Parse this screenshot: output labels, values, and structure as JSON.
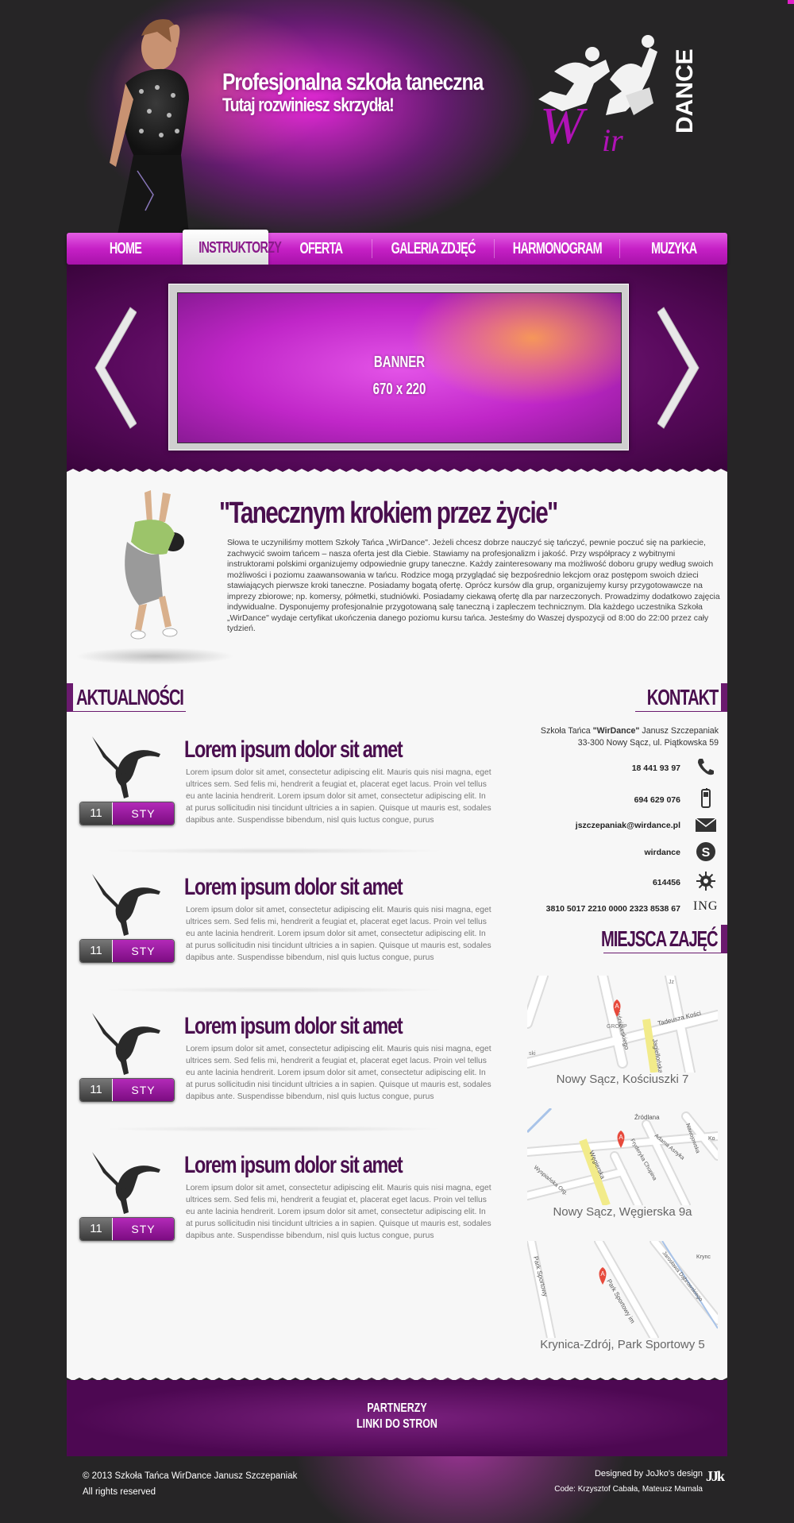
{
  "header": {
    "slogan_line1": "Profesjonalna szkoła taneczna",
    "slogan_line2": "Tutaj rozwiniesz skrzydła!",
    "logo_text_w": "W",
    "logo_text_ir": "ir",
    "logo_text_dance": "DANCE"
  },
  "nav": {
    "items": [
      {
        "label": "HOME"
      },
      {
        "label": "INSTRUKTORZY"
      },
      {
        "label": "OFERTA"
      },
      {
        "label": "GALERIA ZDJĘĆ"
      },
      {
        "label": "HARMONOGRAM"
      },
      {
        "label": "MUZYKA"
      }
    ],
    "active": "INSTRUKTORZY"
  },
  "banner": {
    "line1": "BANNER",
    "line2": "670 x 220"
  },
  "intro": {
    "title": "\"Tanecznym krokiem przez życie\"",
    "text": "Słowa te uczyniliśmy mottem Szkoły Tańca „WirDance\". Jeżeli chcesz dobrze nauczyć się tańczyć, pewnie poczuć się na parkiecie, zachwycić swoim tańcem – nasza oferta jest dla Ciebie. Stawiamy na profesjonalizm i jakość. Przy współpracy z wybitnymi instruktorami polskimi organizujemy odpowiednie grupy taneczne. Każdy zainteresowany ma możliwość doboru grupy według swoich możliwości i poziomu zaawansowania w tańcu. Rodzice mogą przyglądać się bezpośrednio lekcjom oraz postępom swoich dzieci stawiających pierwsze kroki taneczne. Posiadamy bogatą ofertę. Oprócz kursów dla grup, organizujemy kursy przygotowawcze na imprezy zbiorowe; np. komersy, półmetki, studniówki. Posiadamy ciekawą ofertę dla par narzeczonych. Prowadzimy dodatkowo zajęcia indywidualne. Dysponujemy profesjonalnie przygotowaną salę taneczną i zapleczem technicznym. Dla każdego uczestnika Szkoła „WirDance\" wydaje certyfikat ukończenia danego poziomu kursu tańca. Jesteśmy do Waszej dyspozycji od 8:00 do 22:00 przez cały tydzień."
  },
  "news": {
    "heading": "AKTUALNOŚCI",
    "items": [
      {
        "day": "11",
        "month": "STY",
        "title": "Lorem ipsum dolor sit amet",
        "text": "Lorem ipsum dolor sit amet, consectetur adipiscing elit. Mauris quis nisi magna, eget ultrices sem. Sed felis mi, hendrerit a feugiat et, placerat eget lacus. Proin vel tellus eu ante lacinia hendrerit. Lorem ipsum dolor sit amet, consectetur adipiscing elit. In at purus sollicitudin nisi tincidunt ultricies a in sapien. Quisque ut mauris est, sodales dapibus ante. Suspendisse bibendum, nisl quis luctus congue, purus"
      },
      {
        "day": "11",
        "month": "STY",
        "title": "Lorem ipsum dolor sit amet",
        "text": "Lorem ipsum dolor sit amet, consectetur adipiscing elit. Mauris quis nisi magna, eget ultrices sem. Sed felis mi, hendrerit a feugiat et, placerat eget lacus. Proin vel tellus eu ante lacinia hendrerit. Lorem ipsum dolor sit amet, consectetur adipiscing elit. In at purus sollicitudin nisi tincidunt ultricies a in sapien. Quisque ut mauris est, sodales dapibus ante. Suspendisse bibendum, nisl quis luctus congue, purus"
      },
      {
        "day": "11",
        "month": "STY",
        "title": "Lorem ipsum dolor sit amet",
        "text": "Lorem ipsum dolor sit amet, consectetur adipiscing elit. Mauris quis nisi magna, eget ultrices sem. Sed felis mi, hendrerit a feugiat et, placerat eget lacus. Proin vel tellus eu ante lacinia hendrerit. Lorem ipsum dolor sit amet, consectetur adipiscing elit. In at purus sollicitudin nisi tincidunt ultricies a in sapien. Quisque ut mauris est, sodales dapibus ante. Suspendisse bibendum, nisl quis luctus congue, purus"
      },
      {
        "day": "11",
        "month": "STY",
        "title": "Lorem ipsum dolor sit amet",
        "text": "Lorem ipsum dolor sit amet, consectetur adipiscing elit. Mauris quis nisi magna, eget ultrices sem. Sed felis mi, hendrerit a feugiat et, placerat eget lacus. Proin vel tellus eu ante lacinia hendrerit. Lorem ipsum dolor sit amet, consectetur adipiscing elit. In at purus sollicitudin nisi tincidunt ultricies a in sapien. Quisque ut mauris est, sodales dapibus ante. Suspendisse bibendum, nisl quis luctus congue, purus"
      }
    ]
  },
  "contact": {
    "heading": "KONTAKT",
    "school_prefix": "Szkoła Tańca ",
    "school_name": "\"WirDance\"",
    "school_owner": " Janusz Szczepaniak",
    "address": "33-300 Nowy Sącz, ul. Piątkowska 59",
    "phone": "18 441 93 97",
    "mobile": "694 629 076",
    "email": "jszczepaniak@wirdance.pl",
    "skype": "wirdance",
    "gg": "614456",
    "account": "3810 5017 2210 0000 2323 8538 67",
    "bank": "ING"
  },
  "places": {
    "heading": "MIEJSCA ZAJĘĆ",
    "items": [
      {
        "caption": "Nowy Sącz, Kościuszki 7",
        "labels": [
          "Waśniewskiego",
          "Tadeusza Kości",
          "Jagiellońska",
          "GROUP",
          "Jz",
          "ski"
        ]
      },
      {
        "caption": "Nowy Sącz, Węgierska 9a",
        "labels": [
          "Źródlana",
          "Węgierska",
          "Fryderyka Chopina",
          "Adama Asnyka",
          "Wyspiańska Org.",
          "Nawojowska",
          "Ko"
        ]
      },
      {
        "caption": "Krynica-Zdrój, Park Sportowy 5",
        "labels": [
          "Park Sportowy",
          "Park Sportowy im",
          "Jarosława Dąbrowskiego",
          "Krync"
        ]
      }
    ]
  },
  "footer": {
    "partners": "PARTNERZY",
    "links": "LINKI DO STRON",
    "copyright": "© 2013 Szkoła Tańca WirDance Janusz Szczepaniak",
    "rights": "All rights reserved",
    "designed_by": "Designed by JoJko's design",
    "code_by": "Code: Krzysztof Cabała, Mateusz Mamala",
    "designer_logo": "JJk"
  },
  "colors": {
    "accent": "#c620c6",
    "dark_purple": "#4a0f4e",
    "background": "#262526"
  }
}
